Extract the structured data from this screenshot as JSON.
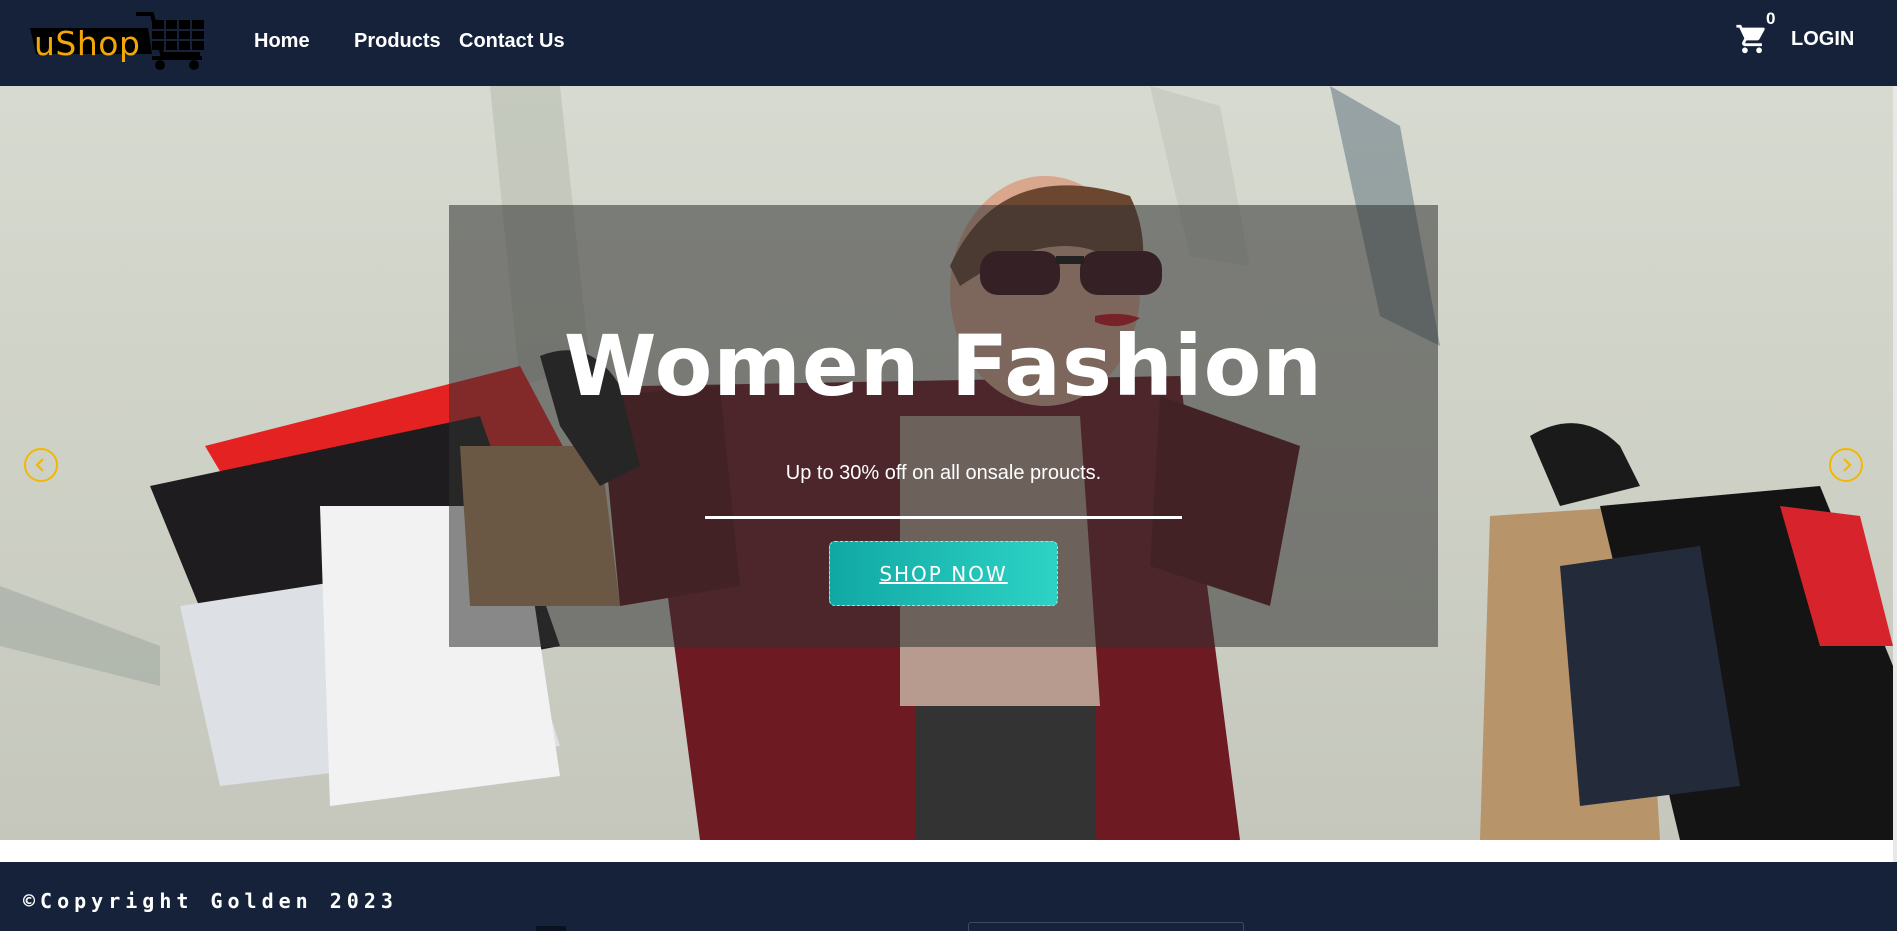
{
  "navbar": {
    "logo_text": "uShop",
    "links": [
      "Home",
      "Products",
      "Contact Us"
    ],
    "cart_count": "0",
    "login_label": "LOGIN",
    "background": "#15223a",
    "logo_color": "#f2a60a"
  },
  "hero": {
    "title": "Women Fashion",
    "subtitle": "Up to 30% off on all onsale proucts.",
    "button_label": "SHOP NOW",
    "button_color": "#1cbdb5",
    "arrow_color": "#f2b705",
    "prev_icon": "chevron-left-icon",
    "next_icon": "chevron-right-icon"
  },
  "footer": {
    "copyright": "©Copyright Golden 2023",
    "background": "#15223a"
  }
}
